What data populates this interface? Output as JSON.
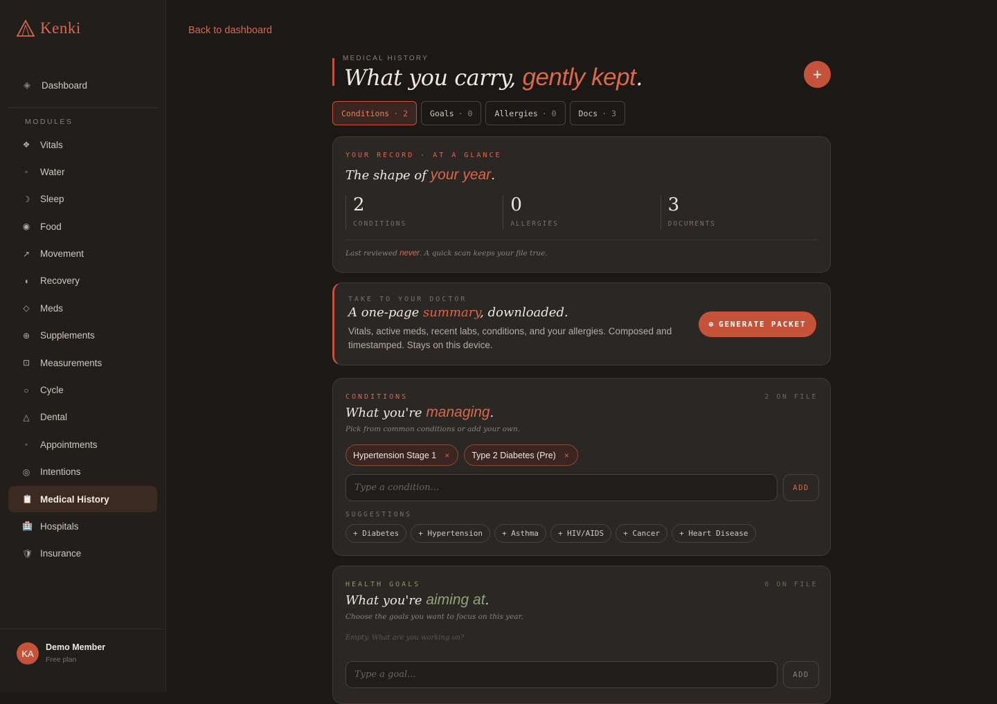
{
  "brand": {
    "name": "Kenki"
  },
  "sidebar": {
    "dashboard": {
      "label": "Dashboard",
      "icon": "diamond-icon"
    },
    "modules_label": "MODULES",
    "items": [
      {
        "label": "Vitals",
        "icon": "vitals-icon",
        "glyph": "❖"
      },
      {
        "label": "Water",
        "icon": "water-icon",
        "glyph": "◦"
      },
      {
        "label": "Sleep",
        "icon": "moon-icon",
        "glyph": "☽"
      },
      {
        "label": "Food",
        "icon": "food-icon",
        "glyph": "◉"
      },
      {
        "label": "Movement",
        "icon": "arrow-icon",
        "glyph": "↗"
      },
      {
        "label": "Recovery",
        "icon": "recovery-icon",
        "glyph": "◖"
      },
      {
        "label": "Meds",
        "icon": "meds-icon",
        "glyph": "◇"
      },
      {
        "label": "Supplements",
        "icon": "supplements-icon",
        "glyph": "⊕"
      },
      {
        "label": "Measurements",
        "icon": "measurements-icon",
        "glyph": "⊡"
      },
      {
        "label": "Cycle",
        "icon": "cycle-icon",
        "glyph": "○"
      },
      {
        "label": "Dental",
        "icon": "dental-icon",
        "glyph": "△"
      },
      {
        "label": "Appointments",
        "icon": "appointments-icon",
        "glyph": "◦"
      },
      {
        "label": "Intentions",
        "icon": "target-icon",
        "glyph": "◎"
      },
      {
        "label": "Medical History",
        "icon": "clipboard-icon",
        "glyph": "📋",
        "active": true
      },
      {
        "label": "Hospitals",
        "icon": "hospital-icon",
        "glyph": "🏥"
      },
      {
        "label": "Insurance",
        "icon": "shield-icon",
        "glyph": "🛡"
      }
    ],
    "user": {
      "initials": "KA",
      "name": "Demo Member",
      "plan": "Free plan"
    }
  },
  "header": {
    "back_label": "Back to dashboard",
    "eyebrow": "MEDICAL HISTORY",
    "title_a": "What you carry, ",
    "title_b": "gently kept",
    "title_c": ".",
    "add_label": "+"
  },
  "tabs": [
    {
      "label": "Conditions",
      "count": "· 2",
      "active": true
    },
    {
      "label": "Goals",
      "count": "· 0"
    },
    {
      "label": "Allergies",
      "count": "· 0"
    },
    {
      "label": "Docs",
      "count": "· 3"
    }
  ],
  "record": {
    "eyebrow": "YOUR RECORD · AT A GLANCE",
    "title_a": "The shape of ",
    "title_b": "your year",
    "title_c": ".",
    "stats": [
      {
        "value": "2",
        "label": "CONDITIONS"
      },
      {
        "value": "0",
        "label": "ALLERGIES"
      },
      {
        "value": "3",
        "label": "DOCUMENTS"
      }
    ],
    "note_a": "Last reviewed ",
    "note_b": "never",
    "note_c": ". A quick scan keeps your file true."
  },
  "doctor": {
    "eyebrow": "TAKE TO YOUR DOCTOR",
    "title_a": "A one-page ",
    "title_b": "summary",
    "title_c": ", downloaded.",
    "description": "Vitals, active meds, recent labs, conditions, and your allergies. Composed and timestamped. Stays on this device.",
    "button_label": "GENERATE PACKET",
    "button_icon": "⊕"
  },
  "conditions": {
    "eyebrow": "CONDITIONS",
    "onfile": "2 ON FILE",
    "title_a": "What you're ",
    "title_b": "managing",
    "title_c": ".",
    "subtitle": "Pick from common conditions or add your own.",
    "chips": [
      {
        "label": "Hypertension Stage 1",
        "remove": "×"
      },
      {
        "label": "Type 2 Diabetes (Pre)",
        "remove": "×"
      }
    ],
    "input_placeholder": "Type a condition...",
    "add_label": "ADD",
    "suggestions_label": "SUGGESTIONS",
    "suggestions": [
      "+ Diabetes",
      "+ Hypertension",
      "+ Asthma",
      "+ HIV/AIDS",
      "+ Cancer",
      "+ Heart Disease"
    ]
  },
  "goals": {
    "eyebrow": "HEALTH GOALS",
    "onfile": "0 ON FILE",
    "title_a": "What you're ",
    "title_b": "aiming at",
    "title_c": ".",
    "subtitle": "Choose the goals you want to focus on this year.",
    "empty": "Empty. What are you working on?",
    "input_placeholder": "Type a goal...",
    "add_label": "ADD"
  },
  "colors": {
    "accent": "#d8694a",
    "accent_dark": "#c5533a",
    "goal_green": "#93a577",
    "background": "#1c1815",
    "card": "#2b2724"
  }
}
